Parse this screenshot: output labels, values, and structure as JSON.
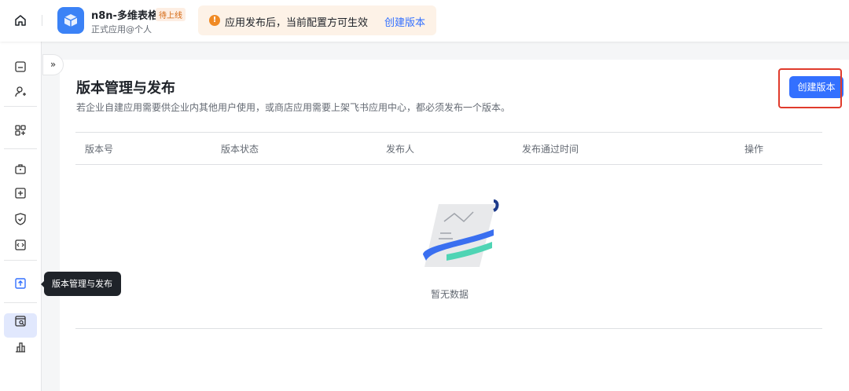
{
  "topbar": {
    "app_name": "n8n-多维表格",
    "status_badge": "待上线",
    "app_subtitle": "正式应用@个人",
    "notice_text": "应用发布后，当前配置方可生效",
    "notice_link": "创建版本"
  },
  "sidebar": {
    "tooltip": "版本管理与发布",
    "active_item": "版本管理与发布"
  },
  "main": {
    "title": "版本管理与发布",
    "description": "若企业自建应用需要供企业内其他用户使用，或商店应用需要上架飞书应用中心，都必须发布一个版本。",
    "create_button": "创建版本",
    "columns": [
      "版本号",
      "版本状态",
      "发布人",
      "发布通过时间",
      "操作"
    ],
    "rows": [],
    "empty_text": "暂无数据"
  },
  "colors": {
    "accent": "#3370ff",
    "highlight": "#e03b2c",
    "notice_bg": "#fdf2e7"
  }
}
